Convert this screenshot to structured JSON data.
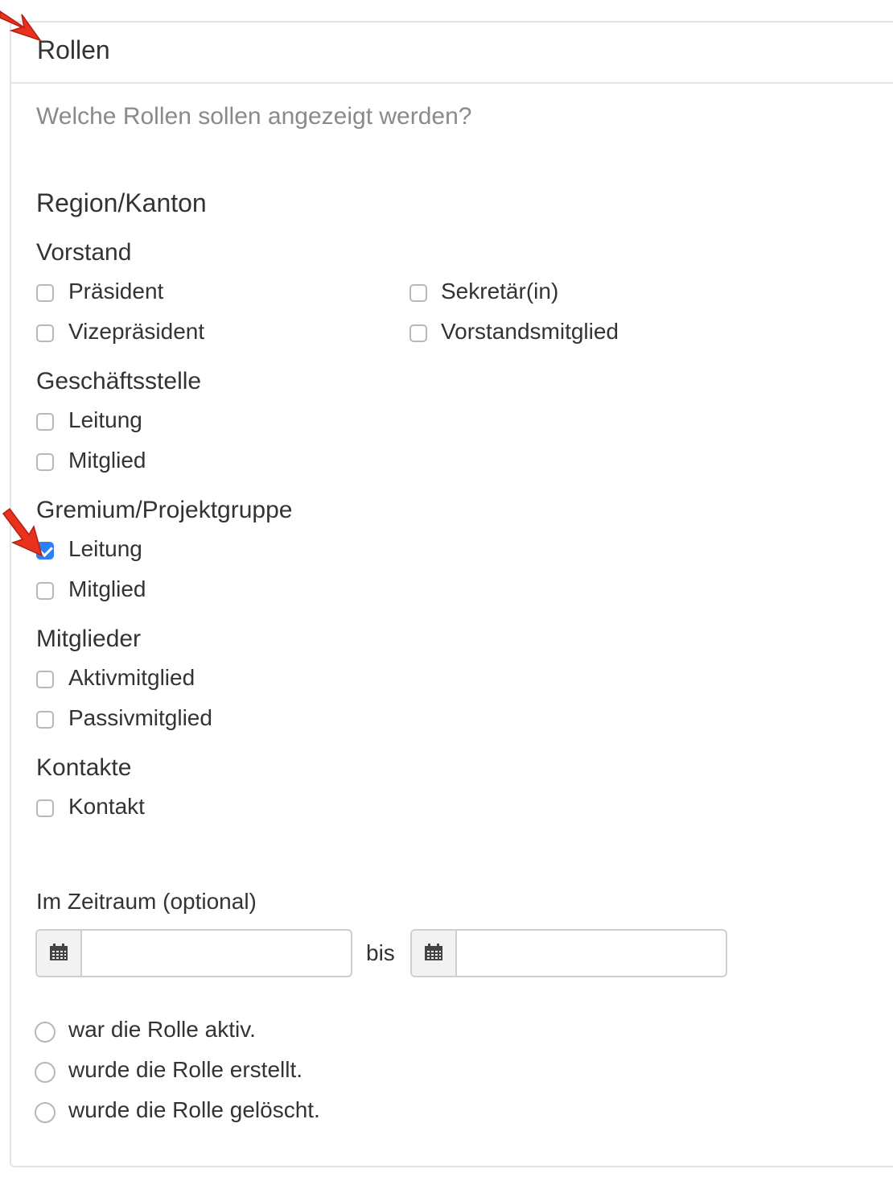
{
  "panel": {
    "title": "Rollen"
  },
  "question": "Welche Rollen sollen angezeigt werden?",
  "region": "Region/Kanton",
  "groups": {
    "vorstand": {
      "title": "Vorstand",
      "roles": [
        "Präsident",
        "Vizepräsident",
        "Sekretär(in)",
        "Vorstandsmitglied"
      ]
    },
    "geschaeftsstelle": {
      "title": "Geschäftsstelle",
      "roles": [
        "Leitung",
        "Mitglied"
      ]
    },
    "gremium": {
      "title": "Gremium/Projektgruppe",
      "roles": [
        "Leitung",
        "Mitglied"
      ],
      "checked": [
        "Leitung"
      ]
    },
    "mitglieder": {
      "title": "Mitglieder",
      "roles": [
        "Aktivmitglied",
        "Passivmitglied"
      ]
    },
    "kontakte": {
      "title": "Kontakte",
      "roles": [
        "Kontakt"
      ]
    }
  },
  "zeitraum": {
    "label": "Im Zeitraum (optional)",
    "from_value": "",
    "to_value": "",
    "separator": "bis",
    "options": [
      "war die Rolle aktiv.",
      "wurde die Rolle erstellt.",
      "wurde die Rolle gelöscht."
    ]
  },
  "icons": {
    "date": "calendar-icon",
    "annotation": "red-arrow-icon"
  },
  "colors": {
    "checkbox_checked": "#2d7ff9",
    "arrow": "#e8321e",
    "muted_text": "#8a8a8a"
  }
}
